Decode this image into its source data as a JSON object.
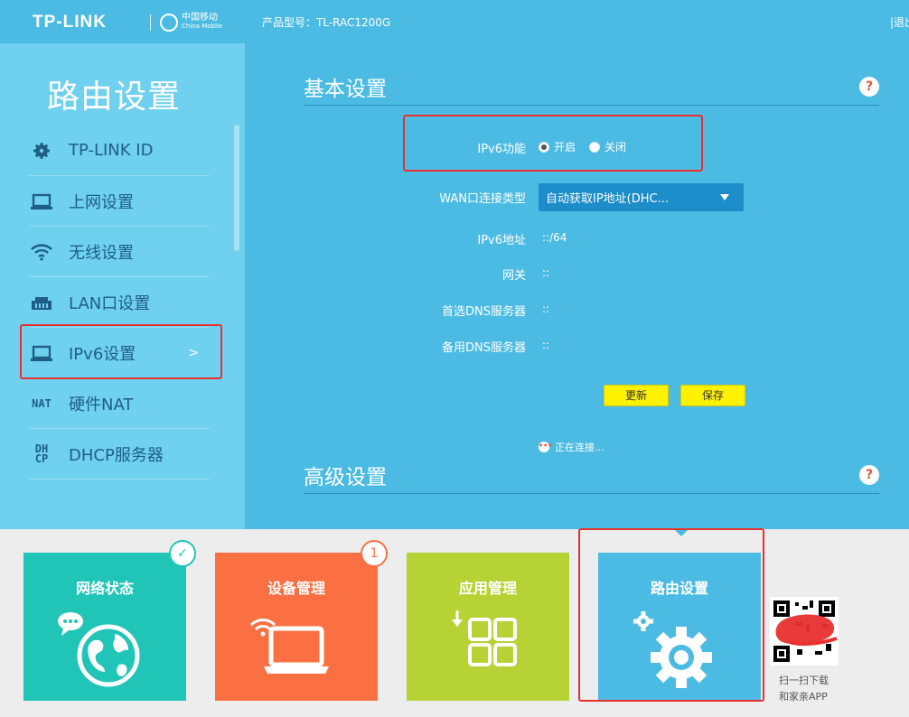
{
  "header": {
    "brand": "TP-LINK",
    "partner_cn": "中国移动",
    "partner_en": "China Mobile",
    "model": "产品型号：TL-RAC1200G",
    "logout": "|退出"
  },
  "sidebar": {
    "title": "路由设置",
    "items": [
      {
        "label": "TP-LINK ID",
        "icon": "gear-icon"
      },
      {
        "label": "上网设置",
        "icon": "laptop-icon"
      },
      {
        "label": "无线设置",
        "icon": "wifi-icon"
      },
      {
        "label": "LAN口设置",
        "icon": "ethernet-icon"
      },
      {
        "label": "IPv6设置",
        "icon": "laptop-icon",
        "active": true,
        "chevron": ">"
      },
      {
        "label": "硬件NAT",
        "icon": "nat-icon",
        "icon_text": "NAT"
      },
      {
        "label": "DHCP服务器",
        "icon": "dhcp-icon",
        "icon_text": "DH\nCP"
      }
    ]
  },
  "basic": {
    "title": "基本设置",
    "help": "?",
    "ipv6_label": "IPv6功能",
    "ipv6_on": "开启",
    "ipv6_off": "关闭",
    "wan_label": "WAN口连接类型",
    "wan_value": "自动获取IP地址(DHC...",
    "addr_label": "IPv6地址",
    "addr_value": "::/64",
    "gateway_label": "网关",
    "gateway_value": "::",
    "dns1_label": "首选DNS服务器",
    "dns1_value": "::",
    "dns2_label": "备用DNS服务器",
    "dns2_value": "::",
    "refresh": "更新",
    "save": "保存",
    "status": "正在连接...",
    "status_icon": "•••"
  },
  "advanced": {
    "title": "高级设置",
    "help": "?"
  },
  "tiles": [
    {
      "label": "网络状态",
      "color": "#21c5b8",
      "badge": "✓",
      "badge_color": "#21c5b8"
    },
    {
      "label": "设备管理",
      "color": "#fa7043",
      "badge": "1",
      "badge_color": "#fa7043"
    },
    {
      "label": "应用管理",
      "color": "#b6d235"
    },
    {
      "label": "路由设置",
      "color": "#4cbbe3"
    }
  ],
  "qr": {
    "caption1": "扫一扫下载",
    "caption2": "和家亲APP"
  }
}
